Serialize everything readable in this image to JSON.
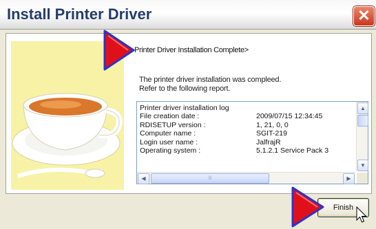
{
  "window": {
    "title": "Install Printer Driver",
    "close_glyph": "✕"
  },
  "heading": "Printer Driver Installation Complete>",
  "message": [
    "The printer driver installation was compleed.",
    "Refer to the following report."
  ],
  "report": {
    "title": "Printer driver installation log",
    "rows": [
      {
        "label": "File creation date :",
        "value": "2009/07/15 12:34:45"
      },
      {
        "label": "RDISETUP version :",
        "value": "1, 21, 0, 0"
      },
      {
        "label": "Computer name :",
        "value": "SGIT-219"
      },
      {
        "label": "Login user name :",
        "value": "JalfrajR"
      },
      {
        "label": "Operating system :",
        "value": "5.1.2.1 Service Pack 3"
      }
    ]
  },
  "scroll": {
    "up": "▲",
    "down": "▼",
    "left": "◀",
    "right": "▶",
    "grip": "|||"
  },
  "buttons": {
    "finish": "Finish"
  },
  "icons": {
    "annotation": "red-arrow-icon",
    "pointer": "mouse-pointer-icon",
    "illustration": "teacup-icon"
  },
  "colors": {
    "annotation_red": "#e0101a",
    "annotation_outline": "#2b34c9",
    "illustration_bg": "#f7f2a6",
    "tea": "#d9772a"
  }
}
